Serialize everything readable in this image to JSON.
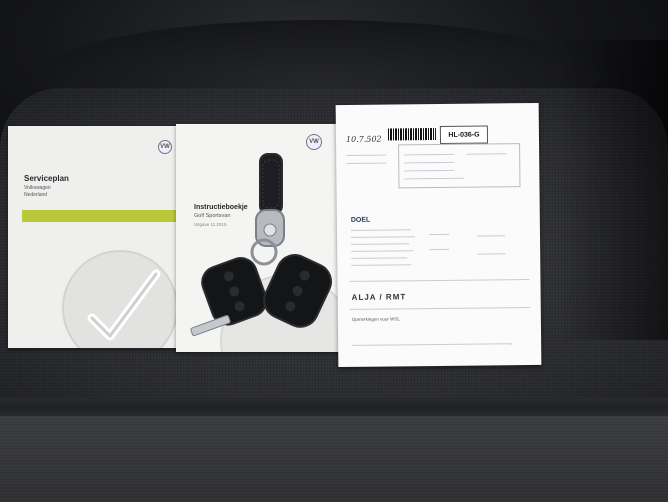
{
  "booklets": [
    {
      "title": "Serviceplan",
      "line1": "Volkswagen",
      "line2": "Nederland",
      "logo": "VW"
    },
    {
      "title": "Instructieboekje",
      "line1": "Golf Sportsvan",
      "line2": "Uitgave 11.2015",
      "logo": "VW"
    }
  ],
  "sheet": {
    "handwriting": "10.7.502",
    "plate": "HL-036-G",
    "heading": "DOEL",
    "stamp": "ALJA / RMT",
    "footer_label": "Opmerkingen voor WSL"
  },
  "colors": {
    "accent_stripe": "#b9c93a",
    "seat": "#2e2f33",
    "paper": "#fbfbfc"
  },
  "icons": [
    "vw-logo-icon",
    "checkmark-icon",
    "car-key-icon"
  ]
}
